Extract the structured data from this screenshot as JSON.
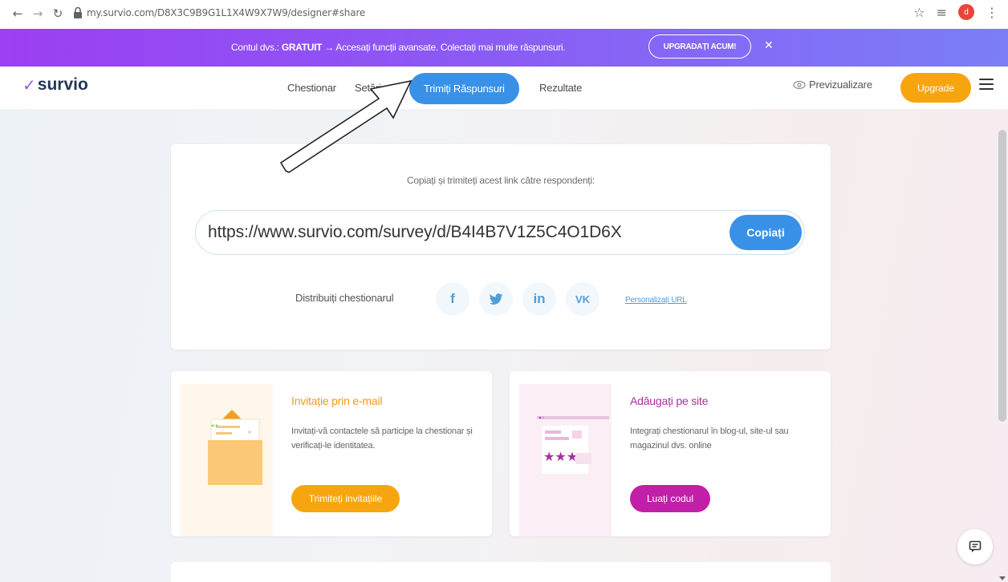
{
  "browser": {
    "url": "my.survio.com/D8X3C9B9G1L1X4W9X7W9/designer#share",
    "profile_initial": "d"
  },
  "banner": {
    "text_prefix": "Contul dvs.: ",
    "text_bold": "GRATUIT",
    "text_suffix": " → Accesați funcții avansate. Colectați mai multe răspunsuri.",
    "button_label": "UPGRADAȚI ACUM!",
    "close_label": "✕"
  },
  "header": {
    "logo_text": "survio",
    "nav": {
      "chestionar": "Chestionar",
      "setari": "Setări",
      "trimiteti": "Trimiți Răspunsuri",
      "rezultate": "Rezultate"
    },
    "preview_label": "Previzualizare",
    "upgrade_label": "Upgrade"
  },
  "share": {
    "caption": "Copiați și trimiteți acest link către respondenți:",
    "link": "https://www.survio.com/survey/d/B4I4B7V1Z5C4O1D6X",
    "copy_label": "Copiați",
    "distribute_label": "Distribuiți chestionarul",
    "social": {
      "facebook": "f",
      "twitter": "🐦",
      "linkedin": "in",
      "vk": "VK"
    },
    "personalize_label": "Personalizați URL"
  },
  "cards": {
    "email": {
      "title": "Invitație prin e-mail",
      "description": "Invitați-vă contactele să participe la chestionar și verificați-le identitatea.",
      "button": "Trimiteți invitațiile"
    },
    "site": {
      "title": "Adăugați pe site",
      "description": "Integrați chestionarul în blog-ul, site-ul sau magazinul dvs. online",
      "button": "Luați codul"
    }
  },
  "colors": {
    "accent_blue": "#3891e6",
    "upgrade_orange": "#f7a50f",
    "site_magenta": "#c21fa8",
    "banner_purple": "#9b3ff2"
  }
}
